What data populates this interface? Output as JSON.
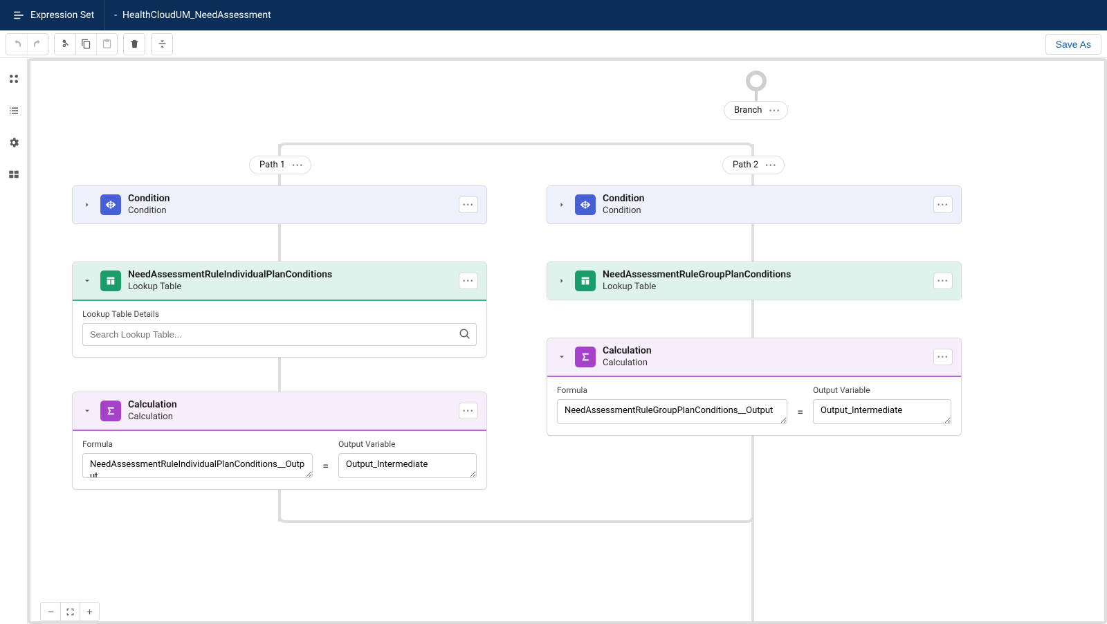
{
  "header": {
    "app_label": "Expression Set",
    "name_prefix": "- ",
    "name": "HealthCloudUM_NeedAssessment",
    "save_as": "Save As"
  },
  "branch": {
    "label": "Branch",
    "paths": [
      "Path 1",
      "Path 2"
    ]
  },
  "path1": {
    "condition": {
      "title": "Condition",
      "subtitle": "Condition"
    },
    "lookup": {
      "title": "NeedAssessmentRuleIndividualPlanConditions",
      "subtitle": "Lookup Table",
      "details_label": "Lookup Table Details",
      "search_placeholder": "Search Lookup Table..."
    },
    "calc": {
      "title": "Calculation",
      "subtitle": "Calculation",
      "formula_label": "Formula",
      "output_label": "Output Variable",
      "formula_value": "NeedAssessmentRuleIndividualPlanConditions__Output",
      "output_value": "Output_Intermediate"
    }
  },
  "path2": {
    "condition": {
      "title": "Condition",
      "subtitle": "Condition"
    },
    "lookup": {
      "title": "NeedAssessmentRuleGroupPlanConditions",
      "subtitle": "Lookup Table"
    },
    "calc": {
      "title": "Calculation",
      "subtitle": "Calculation",
      "formula_label": "Formula",
      "output_label": "Output Variable",
      "formula_value": "NeedAssessmentRuleGroupPlanConditions__Output",
      "output_value": "Output_Intermediate"
    }
  },
  "eq": "="
}
